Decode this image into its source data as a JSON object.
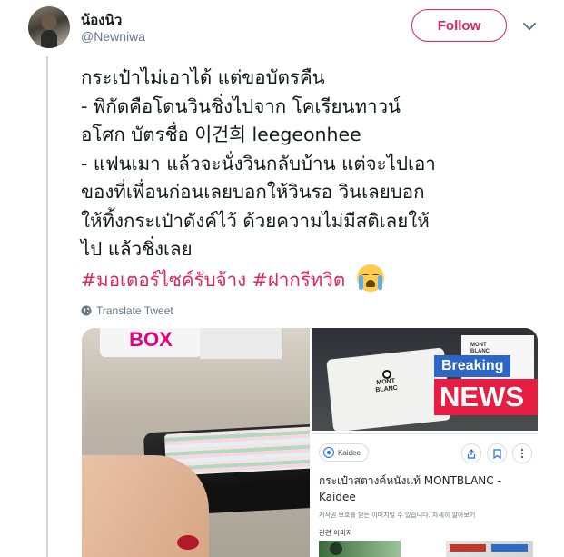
{
  "user": {
    "display_name": "น้องนิว",
    "handle": "@Newniwa",
    "follow_label": "Follow"
  },
  "tweet": {
    "lines": [
      "กระเป๋าไม่เอาได้ แต่ขอบัตรคืน",
      "- พิกัดคือโดนวินชิ่งไปจาก โคเรียนทาวน์",
      "อโศก บัตรชื่อ 이건희 leegeonhee",
      "- แฟนเมา แล้วจะนั่งวินกลับบ้าน แต่จะไปเอา",
      "ของที่เพื่อนก่อนเลยบอกให้วินรอ วินเลยบอก",
      "ให้ทิ้งกระเป๋าดังค์ไว้ ด้วยความไม่มีสติเลยให้",
      "ไป แล้วชิ่งเลย"
    ],
    "hashtags": [
      "#มอเตอร์ไซค์รับจ้าง",
      "#ฝากรีทวิต"
    ],
    "emoji": "loudly-crying-face",
    "translate_label": "Translate Tweet"
  },
  "media": {
    "left_photo": {
      "sign_text": "BOX"
    },
    "right_photo": {
      "brand_logo": "MONT\nBLANC",
      "badge_breaking": "Breaking",
      "badge_news": "NEWS",
      "card_source": "Kaidee",
      "card_title": "กระเป๋าสตางค์หนังแท้ MONTBLANC - Kaidee",
      "card_notice": "저작권 보호를 받는 이미지일 수 있습니다. 자세히 알아보기",
      "card_related": "관련 이미지"
    }
  },
  "colors": {
    "accent": "#e0245e",
    "secondary_text": "#657786",
    "primary_text": "#14171a"
  }
}
